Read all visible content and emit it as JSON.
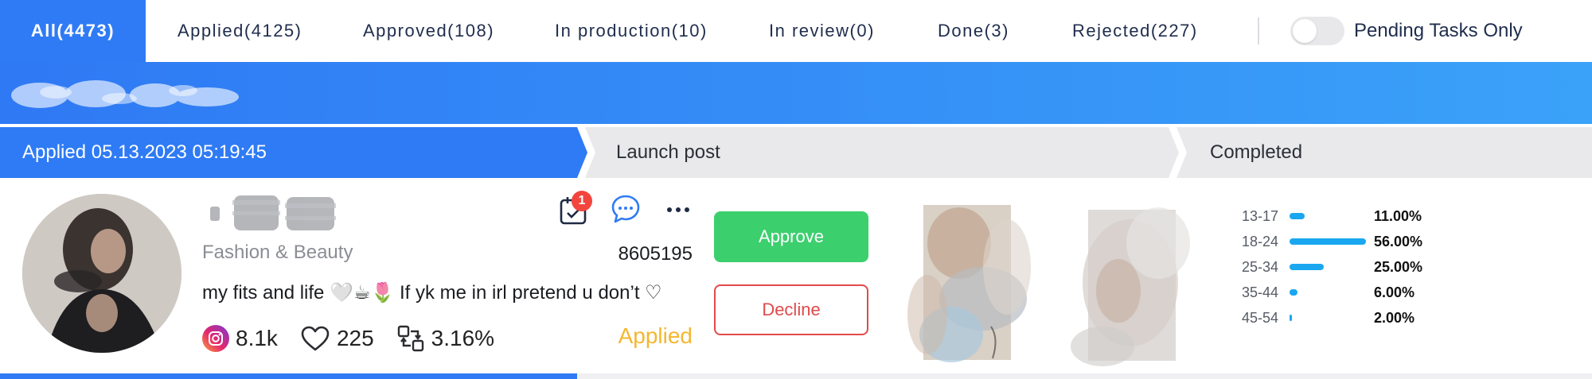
{
  "tabs": [
    {
      "label": "All(4473)",
      "active": true
    },
    {
      "label": "Applied(4125)"
    },
    {
      "label": "Approved(108)"
    },
    {
      "label": "In production(10)"
    },
    {
      "label": "In review(0)"
    },
    {
      "label": "Done(3)"
    },
    {
      "label": "Rejected(227)"
    }
  ],
  "filters": {
    "pending_only_label": "Pending Tasks Only",
    "pending_only_on": false
  },
  "pipeline": {
    "steps": [
      {
        "label": "Applied 05.13.2023 05:19:45",
        "state": "active"
      },
      {
        "label": "Launch post",
        "state": "pending"
      },
      {
        "label": "Completed",
        "state": "pending"
      }
    ]
  },
  "card": {
    "category": "Fashion & Beauty",
    "bio": "my fits and life 🤍☕🌷 If yk me in irl pretend u don’t ♡",
    "user_id": "8605195",
    "status": "Applied",
    "notification_count": "1",
    "stats": {
      "followers": "8.1k",
      "likes": "225",
      "engagement": "3.16%"
    },
    "actions": {
      "approve": "Approve",
      "decline": "Decline"
    },
    "age_distribution": [
      {
        "range": "13-17",
        "pct": "11.00%",
        "value": 11
      },
      {
        "range": "18-24",
        "pct": "56.00%",
        "value": 56
      },
      {
        "range": "25-34",
        "pct": "25.00%",
        "value": 25
      },
      {
        "range": "35-44",
        "pct": "6.00%",
        "value": 6
      },
      {
        "range": "45-54",
        "pct": "2.00%",
        "value": 2
      }
    ]
  },
  "colors": {
    "primary": "#2f7bf5",
    "approve": "#3ccf6e",
    "decline": "#e14a4a",
    "status_applied": "#f4b72f",
    "bar": "#1aa7f0"
  }
}
